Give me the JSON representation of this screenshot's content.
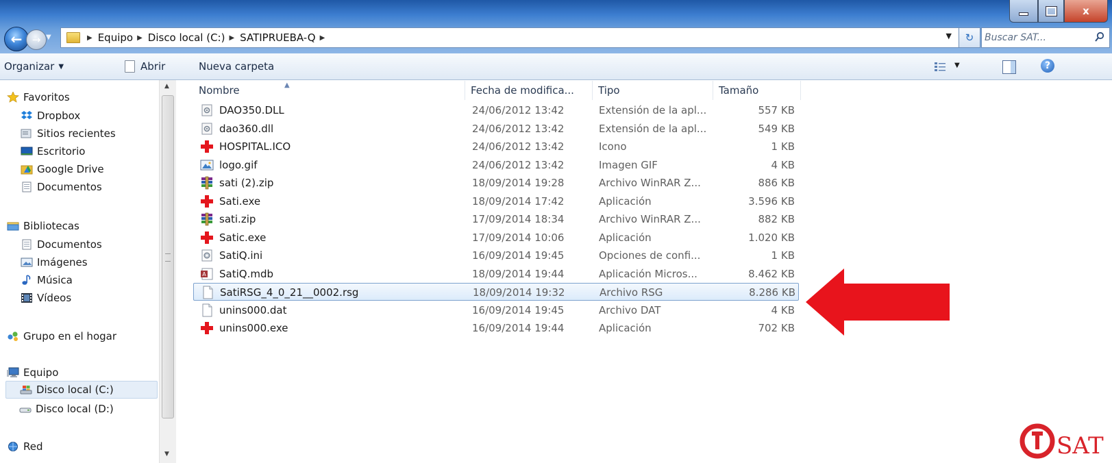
{
  "window": {
    "controls": {
      "minimize": "minimize",
      "maximize": "maximize",
      "close": "x"
    }
  },
  "address": {
    "crumbs": [
      "Equipo",
      "Disco local (C:)",
      "SATIPRUEBA-Q"
    ]
  },
  "search": {
    "placeholder": "Buscar SAT..."
  },
  "toolbar": {
    "organize_label": "Organizar",
    "open_label": "Abrir",
    "new_folder_label": "Nueva carpeta"
  },
  "nav": {
    "favorites_label": "Favoritos",
    "favorites": [
      "Dropbox",
      "Sitios recientes",
      "Escritorio",
      "Google Drive",
      "Documentos"
    ],
    "libraries_label": "Bibliotecas",
    "libraries": [
      "Documentos",
      "Imágenes",
      "Música",
      "Vídeos"
    ],
    "homegroup_label": "Grupo en el hogar",
    "computer_label": "Equipo",
    "computer": [
      "Disco local (C:)",
      "Disco local (D:)"
    ],
    "network_label": "Red"
  },
  "columns": {
    "name": "Nombre",
    "date": "Fecha de modifica...",
    "type": "Tipo",
    "size": "Tamaño"
  },
  "files": [
    {
      "name": "DAO350.DLL",
      "date": "24/06/2012 13:42",
      "type": "Extensión de la apl...",
      "size": "557 KB",
      "icon": "dll-icon"
    },
    {
      "name": "dao360.dll",
      "date": "24/06/2012 13:42",
      "type": "Extensión de la apl...",
      "size": "549 KB",
      "icon": "dll-icon"
    },
    {
      "name": "HOSPITAL.ICO",
      "date": "24/06/2012 13:42",
      "type": "Icono",
      "size": "1 KB",
      "icon": "red-cross-icon"
    },
    {
      "name": "logo.gif",
      "date": "24/06/2012 13:42",
      "type": "Imagen GIF",
      "size": "4 KB",
      "icon": "image-icon"
    },
    {
      "name": "sati (2).zip",
      "date": "18/09/2014 19:28",
      "type": "Archivo WinRAR Z...",
      "size": "886 KB",
      "icon": "winrar-icon"
    },
    {
      "name": "Sati.exe",
      "date": "18/09/2014 17:42",
      "type": "Aplicación",
      "size": "3.596 KB",
      "icon": "red-cross-icon"
    },
    {
      "name": "sati.zip",
      "date": "17/09/2014 18:34",
      "type": "Archivo WinRAR Z...",
      "size": "882 KB",
      "icon": "winrar-icon"
    },
    {
      "name": "Satic.exe",
      "date": "17/09/2014 10:06",
      "type": "Aplicación",
      "size": "1.020 KB",
      "icon": "red-cross-icon"
    },
    {
      "name": "SatiQ.ini",
      "date": "16/09/2014 19:45",
      "type": "Opciones de confi...",
      "size": "1 KB",
      "icon": "settings-file-icon"
    },
    {
      "name": "SatiQ.mdb",
      "date": "18/09/2014 19:44",
      "type": "Aplicación Micros...",
      "size": "8.462 KB",
      "icon": "access-db-icon"
    },
    {
      "name": "SatiRSG_4_0_21__0002.rsg",
      "date": "18/09/2014 19:32",
      "type": "Archivo RSG",
      "size": "8.286 KB",
      "icon": "blank-file-icon",
      "highlighted": true
    },
    {
      "name": "unins000.dat",
      "date": "16/09/2014 19:45",
      "type": "Archivo DAT",
      "size": "4 KB",
      "icon": "blank-file-icon"
    },
    {
      "name": "unins000.exe",
      "date": "16/09/2014 19:44",
      "type": "Aplicación",
      "size": "702 KB",
      "icon": "red-cross-icon"
    }
  ],
  "colors": {
    "highlight_arrow": "#e8141c",
    "selection": "#dcebfb",
    "brand_logo": "#d8232a"
  },
  "logo": {
    "text": "SAT"
  }
}
